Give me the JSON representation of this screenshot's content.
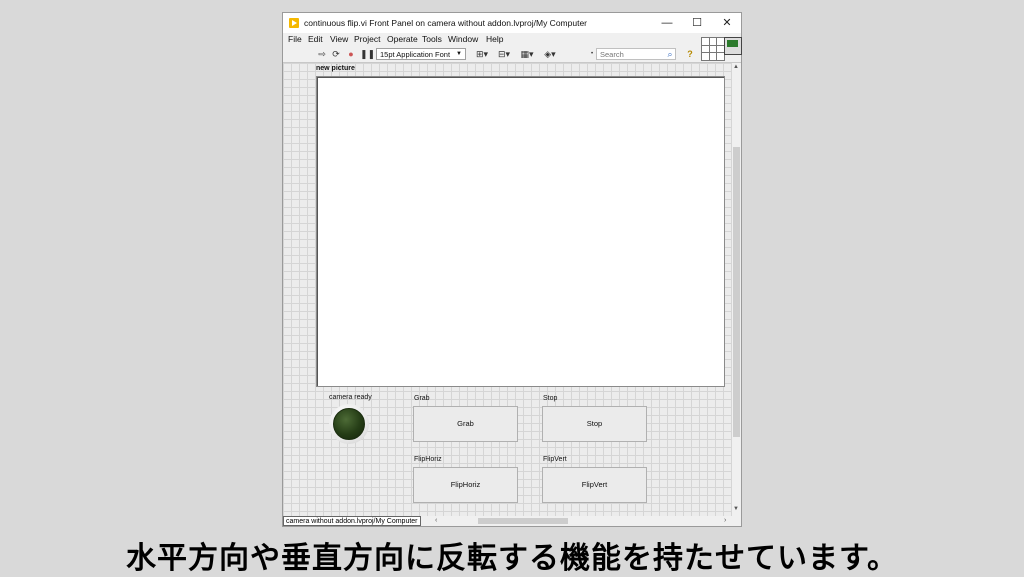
{
  "window": {
    "title": "continuous flip.vi Front Panel on camera without addon.lvproj/My Computer",
    "minimize_glyph": "—",
    "maximize_glyph": "☐",
    "close_glyph": "✕"
  },
  "menu": {
    "items": [
      "File",
      "Edit",
      "View",
      "Project",
      "Operate",
      "Tools",
      "Window",
      "Help"
    ]
  },
  "toolbar": {
    "font_select": "15pt Application Font",
    "search_placeholder": "Search",
    "icons": [
      "run-arrow-icon",
      "run-continuous-icon",
      "abort-icon",
      "pause-icon",
      "align-icon",
      "distribute-icon",
      "resize-icon",
      "reorder-icon",
      "search-icon",
      "help-icon"
    ]
  },
  "panel": {
    "picture_label": "new picture",
    "led_label": "camera ready",
    "led_color": "#253d16",
    "controls": {
      "grab": {
        "label": "Grab",
        "button_text": "Grab"
      },
      "stop": {
        "label": "Stop",
        "button_text": "Stop"
      },
      "flip_horiz": {
        "label": "FlipHoriz",
        "button_text": "FlipHoriz"
      },
      "flip_vert": {
        "label": "FlipVert",
        "button_text": "FlipVert"
      }
    }
  },
  "statusbar": {
    "context": "camera without addon.lvproj/My Computer"
  },
  "caption": "水平方向や垂直方向に反転する機能を持たせています。"
}
